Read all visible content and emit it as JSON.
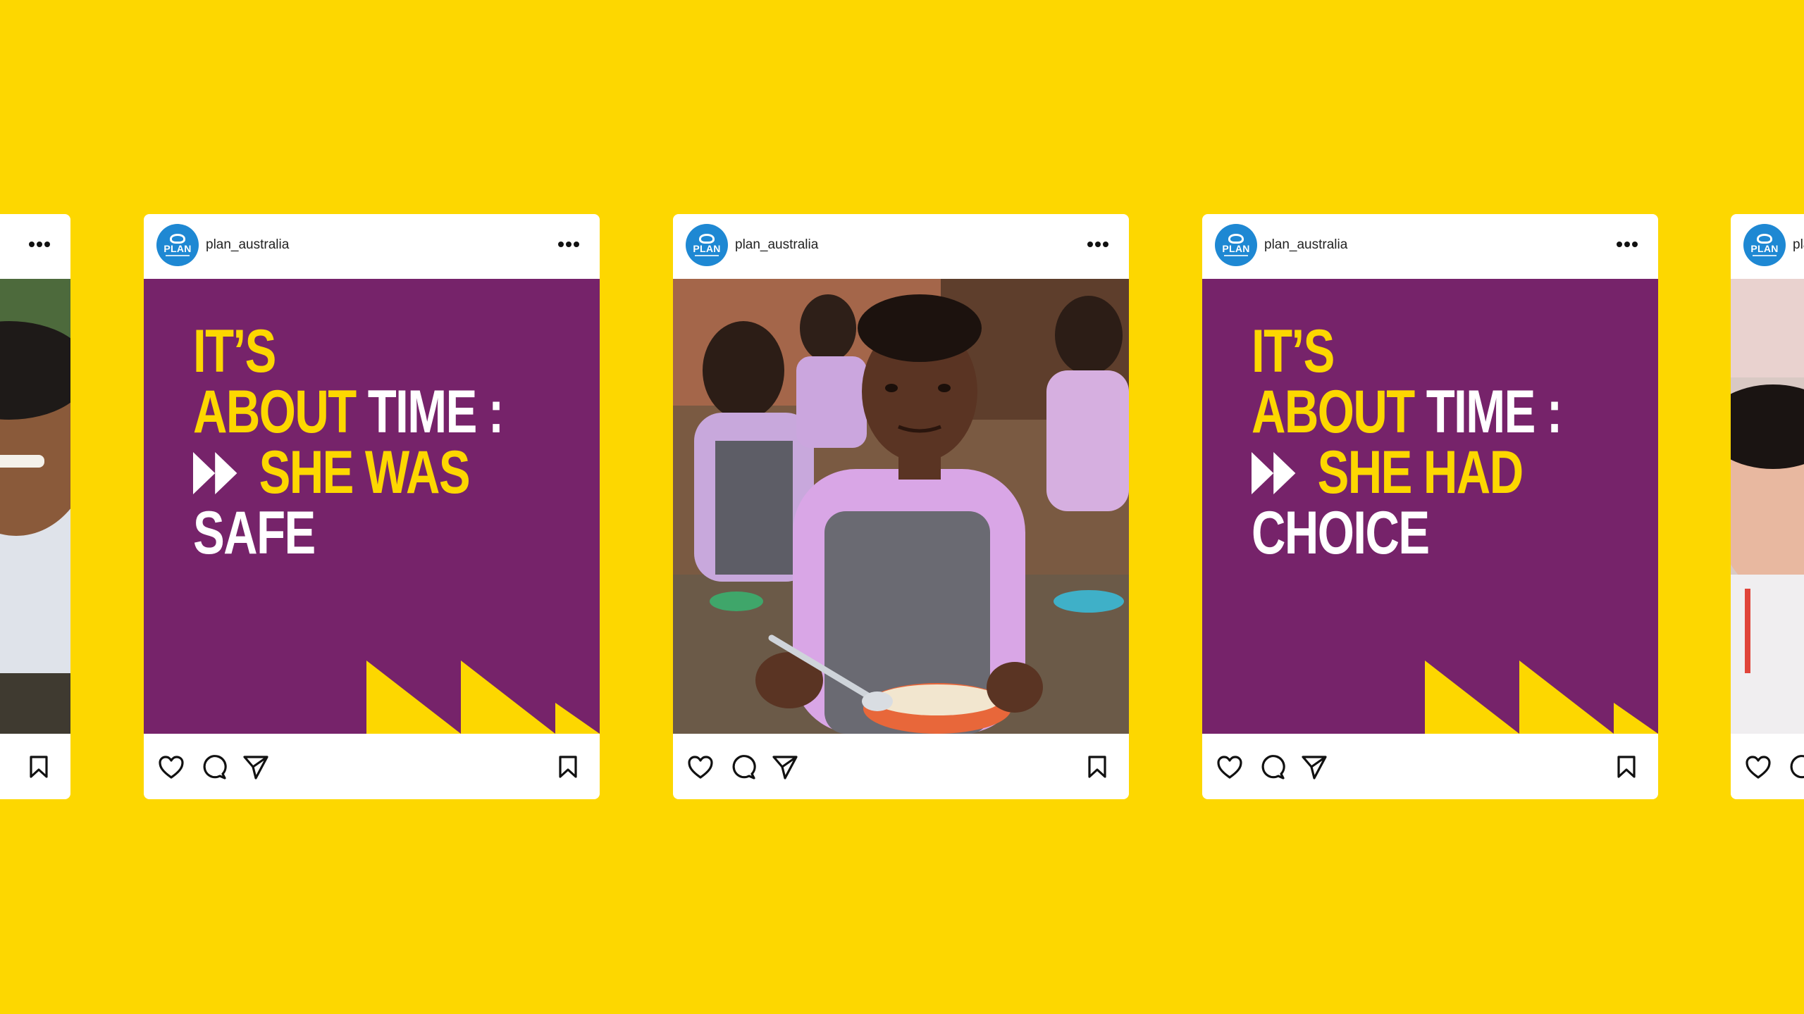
{
  "colors": {
    "background": "#FDD700",
    "brand_purple": "#76236A",
    "brand_yellow": "#FDD700",
    "avatar_blue": "#1E88D3"
  },
  "account": {
    "username": "plan_australia",
    "avatar_text": "PLAN"
  },
  "icons": {
    "more": "more-horizontal-icon",
    "like": "heart-icon",
    "comment": "comment-icon",
    "share": "send-icon",
    "save": "bookmark-icon",
    "fast_forward": "fast-forward-icon"
  },
  "posts": [
    {
      "type": "graphic",
      "headline": {
        "line1": "IT’S",
        "line2a": "ABOUT",
        "line2b": "TIME :",
        "line3": "SHE WAS",
        "line4": "SAFE"
      }
    },
    {
      "type": "photo",
      "alt": "Smiling schoolgirl in a lilac uniform eating a meal from an orange bowl"
    },
    {
      "type": "graphic",
      "headline": {
        "line1": "IT’S",
        "line2a": "ABOUT",
        "line2b": "TIME :",
        "line3": "SHE HAD",
        "line4": "CHOICE"
      }
    }
  ]
}
